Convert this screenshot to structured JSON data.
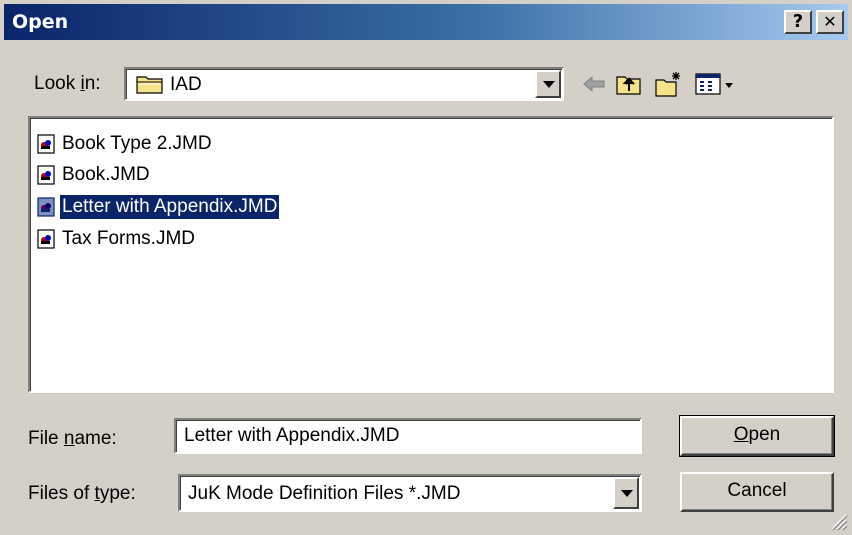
{
  "window": {
    "title": "Open"
  },
  "titlebar": {
    "help_label": "?",
    "close_label": "✕"
  },
  "lookin": {
    "label": "Look in:",
    "value": "IAD"
  },
  "files": [
    {
      "name": "Book Type 2.JMD",
      "selected": false
    },
    {
      "name": "Book.JMD",
      "selected": false
    },
    {
      "name": "Letter with Appendix.JMD",
      "selected": true
    },
    {
      "name": "Tax Forms.JMD",
      "selected": false
    }
  ],
  "filename": {
    "label": "File name:",
    "value": "Letter with Appendix.JMD"
  },
  "filetype": {
    "label": "Files of type:",
    "value": "JuK Mode Definition Files *.JMD"
  },
  "buttons": {
    "open": "Open",
    "cancel": "Cancel"
  },
  "colors": {
    "title_gradient_start": "#0a246a",
    "title_gradient_end": "#a6caf0",
    "selection": "#0a246a",
    "face": "#d4d0c8"
  }
}
